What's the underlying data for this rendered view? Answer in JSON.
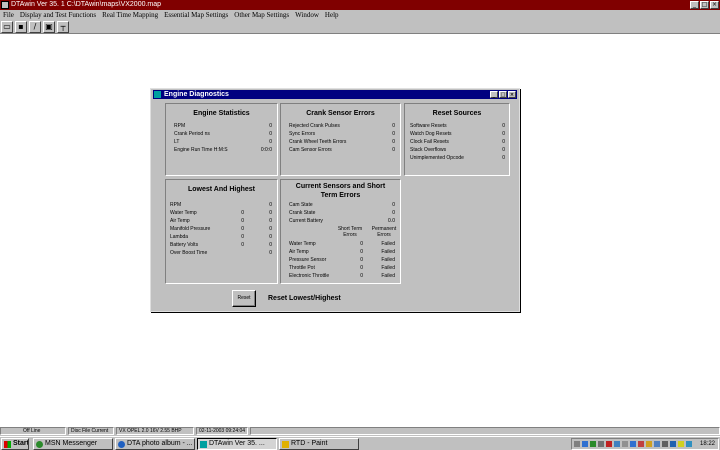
{
  "app": {
    "title": "DTAwin Ver  35. 1  C:\\DTAwin\\maps\\VX2000.map",
    "minimize": "_",
    "maximize": "□",
    "close": "×"
  },
  "menu": [
    "File",
    "Display and Test Functions",
    "Real Time Mapping",
    "Essential Map Settings",
    "Other Map Settings",
    "Window",
    "Help"
  ],
  "toolbar": {
    "icons": [
      "open-folder-icon",
      "save-disk-icon",
      "edit-pencil-icon",
      "print-icon",
      "connect-icon"
    ],
    "glyphs": [
      "▭",
      "▪",
      "/",
      "▣",
      "┬"
    ]
  },
  "dialog": {
    "title": "Engine Diagnostics",
    "engine_statistics": {
      "title": "Engine Statistics",
      "rows": [
        {
          "label": "RPM",
          "value": "0"
        },
        {
          "label": "Crank Period ns",
          "value": "0"
        },
        {
          "label": "LT",
          "value": "0"
        },
        {
          "label": "Engine Run Time H:M:S",
          "value": "0:0:0"
        }
      ]
    },
    "crank_sensor_errors": {
      "title": "Crank Sensor Errors",
      "rows": [
        {
          "label": "Rejected Crank Pulses",
          "value": "0"
        },
        {
          "label": "Sync Errors",
          "value": "0"
        },
        {
          "label": "Crank Wheel Teeth Errors",
          "value": "0"
        },
        {
          "label": "Cam Sensor Errors",
          "value": "0"
        }
      ]
    },
    "reset_sources": {
      "title": "Reset Sources",
      "rows": [
        {
          "label": "Software Resets",
          "value": "0"
        },
        {
          "label": "Watch Dog Resets",
          "value": "0"
        },
        {
          "label": "Clock Fail Resets",
          "value": "0"
        },
        {
          "label": "Stack Overflows",
          "value": "0"
        },
        {
          "label": "Unimplemented Opcode",
          "value": "0"
        }
      ]
    },
    "lowest_highest": {
      "title": "Lowest And Highest",
      "rows": [
        {
          "label": "RPM",
          "low": "",
          "high": "0"
        },
        {
          "label": "Water Temp",
          "low": "0",
          "high": "0"
        },
        {
          "label": "Air Temp",
          "low": "0",
          "high": "0"
        },
        {
          "label": "Manifold Pressure",
          "low": "0",
          "high": "0"
        },
        {
          "label": "Lambda",
          "low": "0",
          "high": "0"
        },
        {
          "label": "Battery Volts",
          "low": "0",
          "high": "0"
        },
        {
          "label": "Over Boost Time",
          "low": "",
          "high": "0"
        }
      ]
    },
    "current_sensors": {
      "title": "Current Sensors and Short Term Errors",
      "top_rows": [
        {
          "label": "Cam State",
          "value": "0"
        },
        {
          "label": "Crank State",
          "value": "0"
        },
        {
          "label": "Current Battery",
          "value": "0.0"
        }
      ],
      "col_short": "Short Term Errors",
      "col_perm": "Permanent Errors",
      "rows": [
        {
          "label": "Water Temp",
          "short": "0",
          "perm": "Failed"
        },
        {
          "label": "Air Temp",
          "short": "0",
          "perm": "Failed"
        },
        {
          "label": "Pressure Sensor",
          "short": "0",
          "perm": "Failed"
        },
        {
          "label": "Throttle Pot",
          "short": "0",
          "perm": "Failed"
        },
        {
          "label": "Electronic Throttle",
          "short": "0",
          "perm": "Failed"
        }
      ]
    },
    "reset_button": "Reset",
    "reset_caption": "Reset Lowest/Highest"
  },
  "status": [
    "Off Line",
    "Disc File Current",
    "VX OPEL 2.0 16V 2.55 BHP",
    "02-11-2003 09:24:04"
  ],
  "taskbar": {
    "start": "Start",
    "tasks": [
      "MSN Messenger",
      "DTA photo album - ...",
      "DTAwin Ver  35. ...",
      "RTD - Paint"
    ],
    "clock": "18:22"
  },
  "colors": {
    "app_titlebar": "#800000",
    "dialog_titlebar": "#000080",
    "face": "#c0c0c0"
  }
}
